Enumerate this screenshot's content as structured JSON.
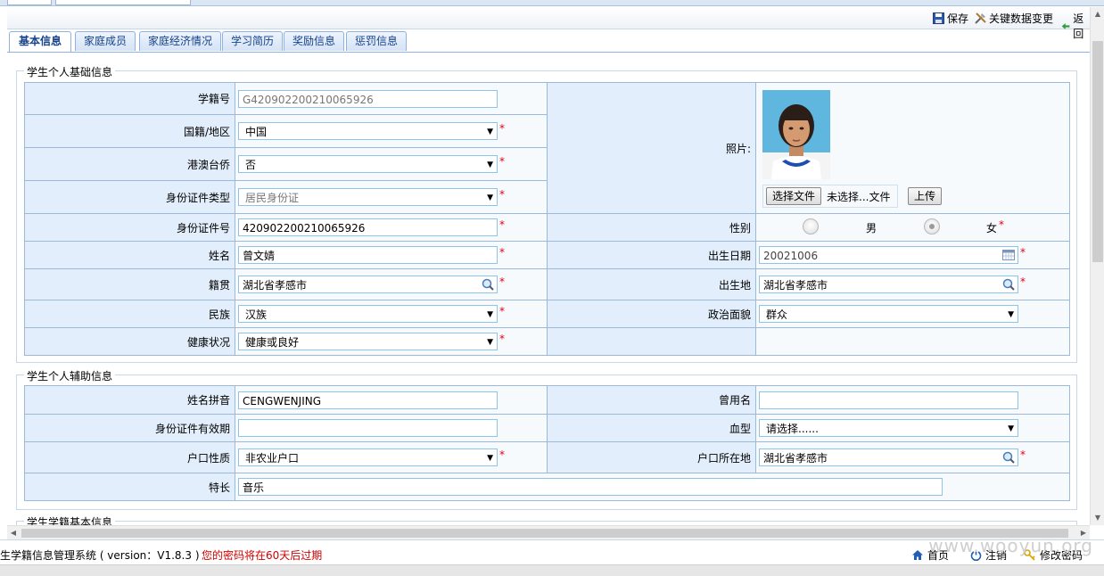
{
  "toolbar": {
    "save_label": "保存",
    "keychange_label": "关键数据变更",
    "back_label": "返回"
  },
  "tabs": [
    {
      "label": "基本信息",
      "active": true
    },
    {
      "label": "家庭成员"
    },
    {
      "label": "家庭经济情况"
    },
    {
      "label": "学习简历"
    },
    {
      "label": "奖励信息"
    },
    {
      "label": "惩罚信息"
    }
  ],
  "section_basic": {
    "title": "学生个人基础信息",
    "xjh_label": "学籍号",
    "xjh_value": "G420902200210065926",
    "nationality_label": "国籍/地区",
    "nationality_value": "中国",
    "gat_label": "港澳台侨",
    "gat_value": "否",
    "idtype_label": "身份证件类型",
    "idtype_value": "居民身份证",
    "photo_label": "照片:",
    "choose_file": "选择文件",
    "no_file": "未选择...文件",
    "upload": "上传",
    "idno_label": "身份证件号",
    "idno_value": "420902200210065926",
    "gender_label": "性别",
    "gender_male": "男",
    "gender_female": "女",
    "gender_value": "女",
    "name_label": "姓名",
    "name_value": "曾文婧",
    "birth_label": "出生日期",
    "birth_value": "20021006",
    "jiguan_label": "籍贯",
    "jiguan_value": "湖北省孝感市",
    "birthplace_label": "出生地",
    "birthplace_value": "湖北省孝感市",
    "ethnic_label": "民族",
    "ethnic_value": "汉族",
    "political_label": "政治面貌",
    "political_value": "群众",
    "health_label": "健康状况",
    "health_value": "健康或良好"
  },
  "section_aux": {
    "title": "学生个人辅助信息",
    "pinyin_label": "姓名拼音",
    "pinyin_value": "CENGWENJING",
    "formername_label": "曾用名",
    "formername_value": "",
    "idvalid_label": "身份证件有效期",
    "idvalid_value": "",
    "blood_label": "血型",
    "blood_value": "请选择......",
    "hukou_type_label": "户口性质",
    "hukou_type_value": "非农业户口",
    "hukou_loc_label": "户口所在地",
    "hukou_loc_value": "湖北省孝感市",
    "specialty_label": "特长",
    "specialty_value": "音乐"
  },
  "section_school": {
    "title": "学生学籍基本信息"
  },
  "status": {
    "system": "生学籍信息管理系统 ( version：V1.8.3 )",
    "warning": "您的密码将在60天后过期",
    "home": "首页",
    "logout": "注销",
    "change_pwd": "修改密码"
  },
  "watermark": "www.wooyun.org",
  "colors": {
    "label_bg": "#e2eefb",
    "border": "#9db9d9",
    "tab_text": "#15428b",
    "required": "#e0001b",
    "warning": "#d40000"
  }
}
